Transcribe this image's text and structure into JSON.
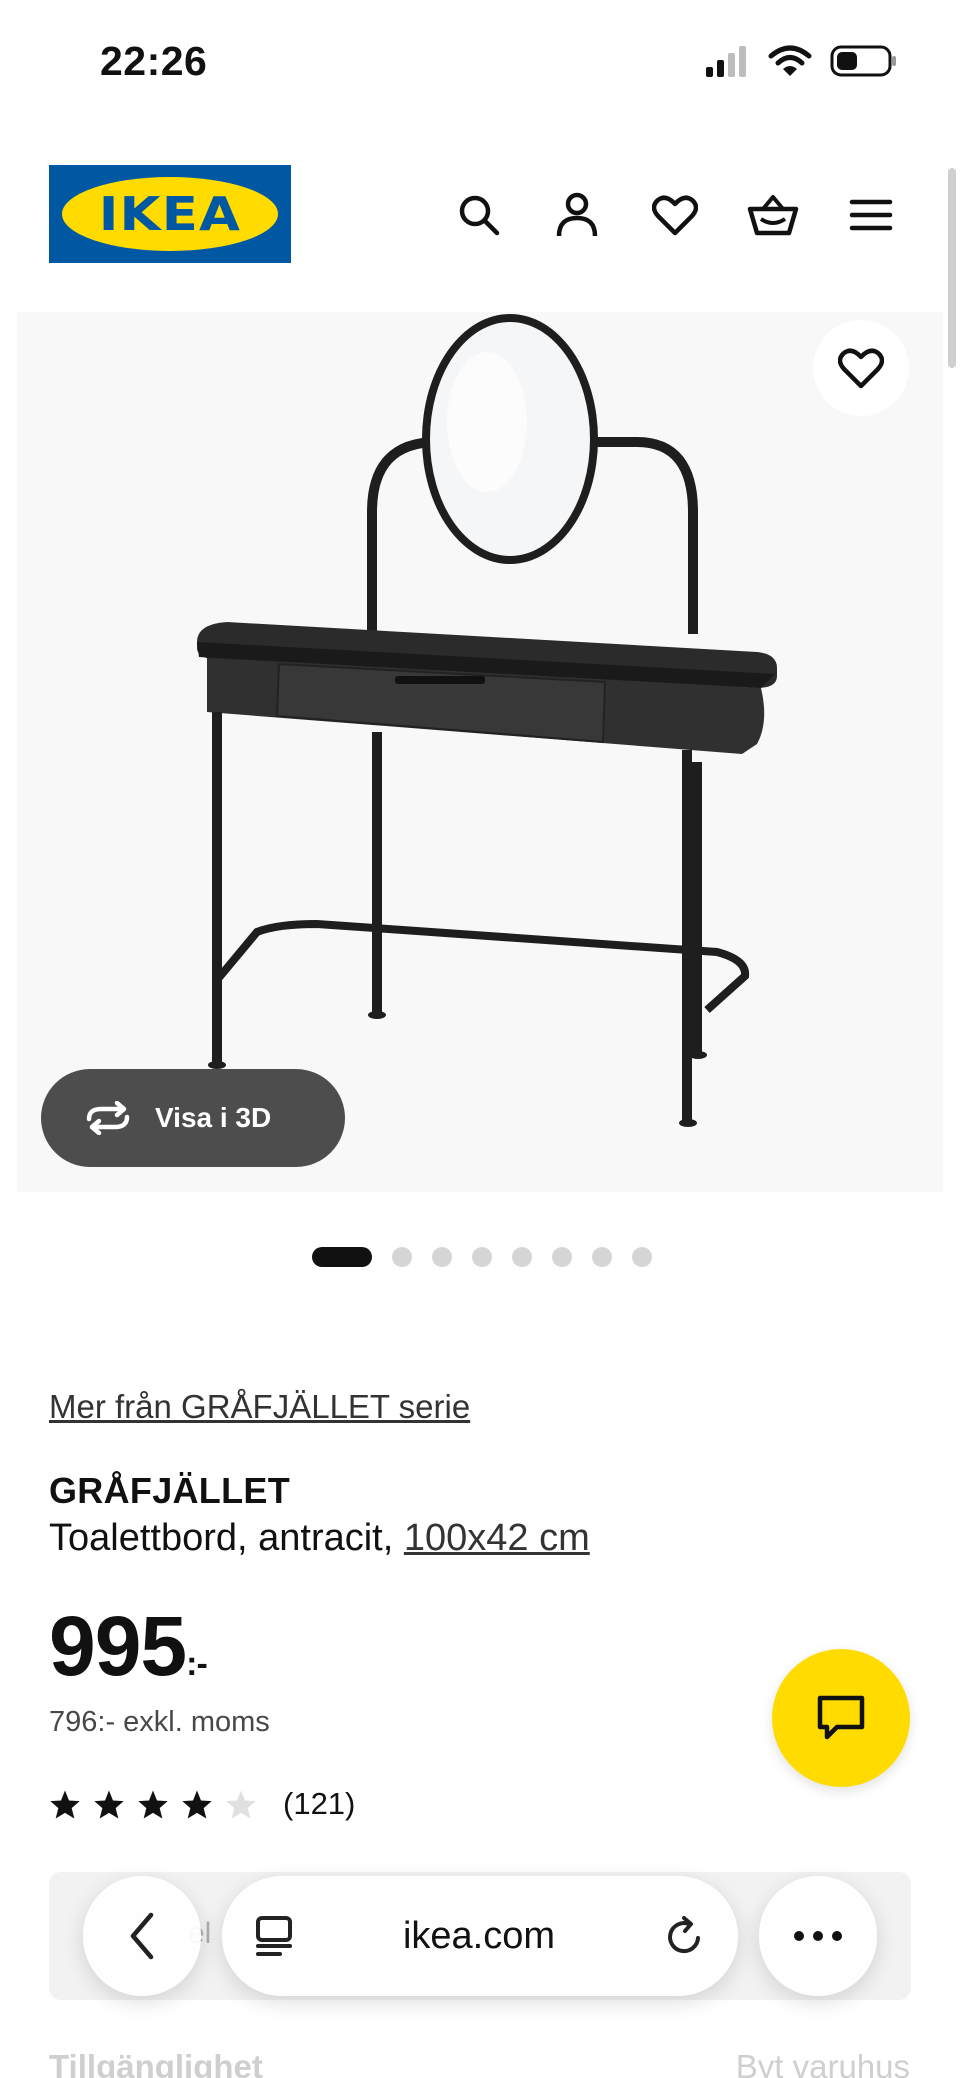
{
  "status_bar": {
    "time": "22:26"
  },
  "header": {
    "logo_text": "IKEA",
    "icons": [
      "search-icon",
      "user-icon",
      "heart-icon",
      "cart-icon",
      "menu-icon"
    ]
  },
  "gallery": {
    "view_3d_label": "Visa i 3D",
    "dot_count": 8,
    "active_dot": 1
  },
  "product": {
    "series_link": "Mer från GRÅFJÄLLET serie",
    "name": "GRÅFJÄLLET",
    "description_prefix": "Toalettbord, antracit, ",
    "size_link": "100x42 cm",
    "price_main": "995",
    "price_suffix": ":-",
    "price_excl": "796:- exkl. moms",
    "rating": 4,
    "rating_max": 5,
    "review_count": "(121)"
  },
  "behind_toolbar": {
    "partial_text": "el",
    "left_label": "Tillgänglighet",
    "right_label": "Byt varuhus"
  },
  "browser_toolbar": {
    "url": "ikea.com"
  },
  "colors": {
    "ikea_blue": "#0058a3",
    "ikea_yellow": "#ffdb00",
    "pill_dark": "#4d4d4d",
    "text": "#111111"
  }
}
